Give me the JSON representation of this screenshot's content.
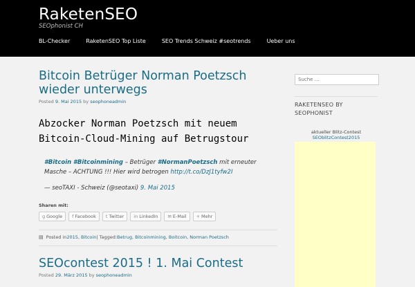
{
  "site": {
    "title": "RaketenSEO",
    "description": "SEOphonist CH"
  },
  "nav": [
    {
      "label": "BL-Checker"
    },
    {
      "label": "RaketenSEO Top Liste"
    },
    {
      "label": "SEO Trends Schweiz #seotrends"
    },
    {
      "label": "Ueber uns"
    }
  ],
  "post1": {
    "title": "Bitcoin Betrüger Norman Poetzsch wieder unterwegs",
    "meta_prefix": "Posted",
    "date": "9. Mai 2015",
    "by": "by",
    "author": "seophoneadmin",
    "lead": "Abzocker Norman Poetzsch mit neuem Bitcoin-Cloud-Mining auf Betrugstour",
    "quote": {
      "tag1": "#Bitcoin",
      "tag2": "#Bitcoinmining",
      "text1": " – Betrüger ",
      "tag3": "#NormanPoetzsch",
      "text2": " mit erneuter Masche – ACHTUNG !!! Hier wird betrogen ",
      "link": "http://t.co/DzJ1tyfw2I",
      "cite_text": "— seoTAXI - Schweiz (@seotaxi) ",
      "cite_date": "9. Mai 2015"
    },
    "share_label": "Sharen mit:",
    "share_buttons": [
      {
        "label": "Google",
        "icon": "g"
      },
      {
        "label": "Facebook",
        "icon": "f"
      },
      {
        "label": "Twitter",
        "icon": "t"
      },
      {
        "label": "LinkedIn",
        "icon": "in"
      },
      {
        "label": "E-Mail",
        "icon": "✉"
      },
      {
        "label": "Mehr",
        "icon": "+"
      }
    ],
    "footer": {
      "posted_in": "Posted in ",
      "cat1": "2015",
      "cat2": "Bitcoin",
      "tagged": " | Tagged: ",
      "tags": [
        "Betrug",
        "Bitcoinmining",
        "Boitcoin",
        "Norman Poetzsch"
      ]
    }
  },
  "post2": {
    "title": "SEOcontest 2015 ! 1. Mai Contest",
    "meta_prefix": "Posted",
    "date": "29. März 2015",
    "by": "by",
    "author": "seophoneadmin"
  },
  "sidebar": {
    "search_placeholder": "Suche …",
    "widget_title": "RAKETENSEO BY SEOPHONIST",
    "widget_sub": "aktueller Blitz-Contest",
    "widget_link": "SEOblitzContest2015",
    "contest_color": "#ffffc6"
  },
  "colors": {
    "link": "#1a6c87",
    "header_bg": "#000000",
    "page_bg": "#f2f2f2"
  }
}
